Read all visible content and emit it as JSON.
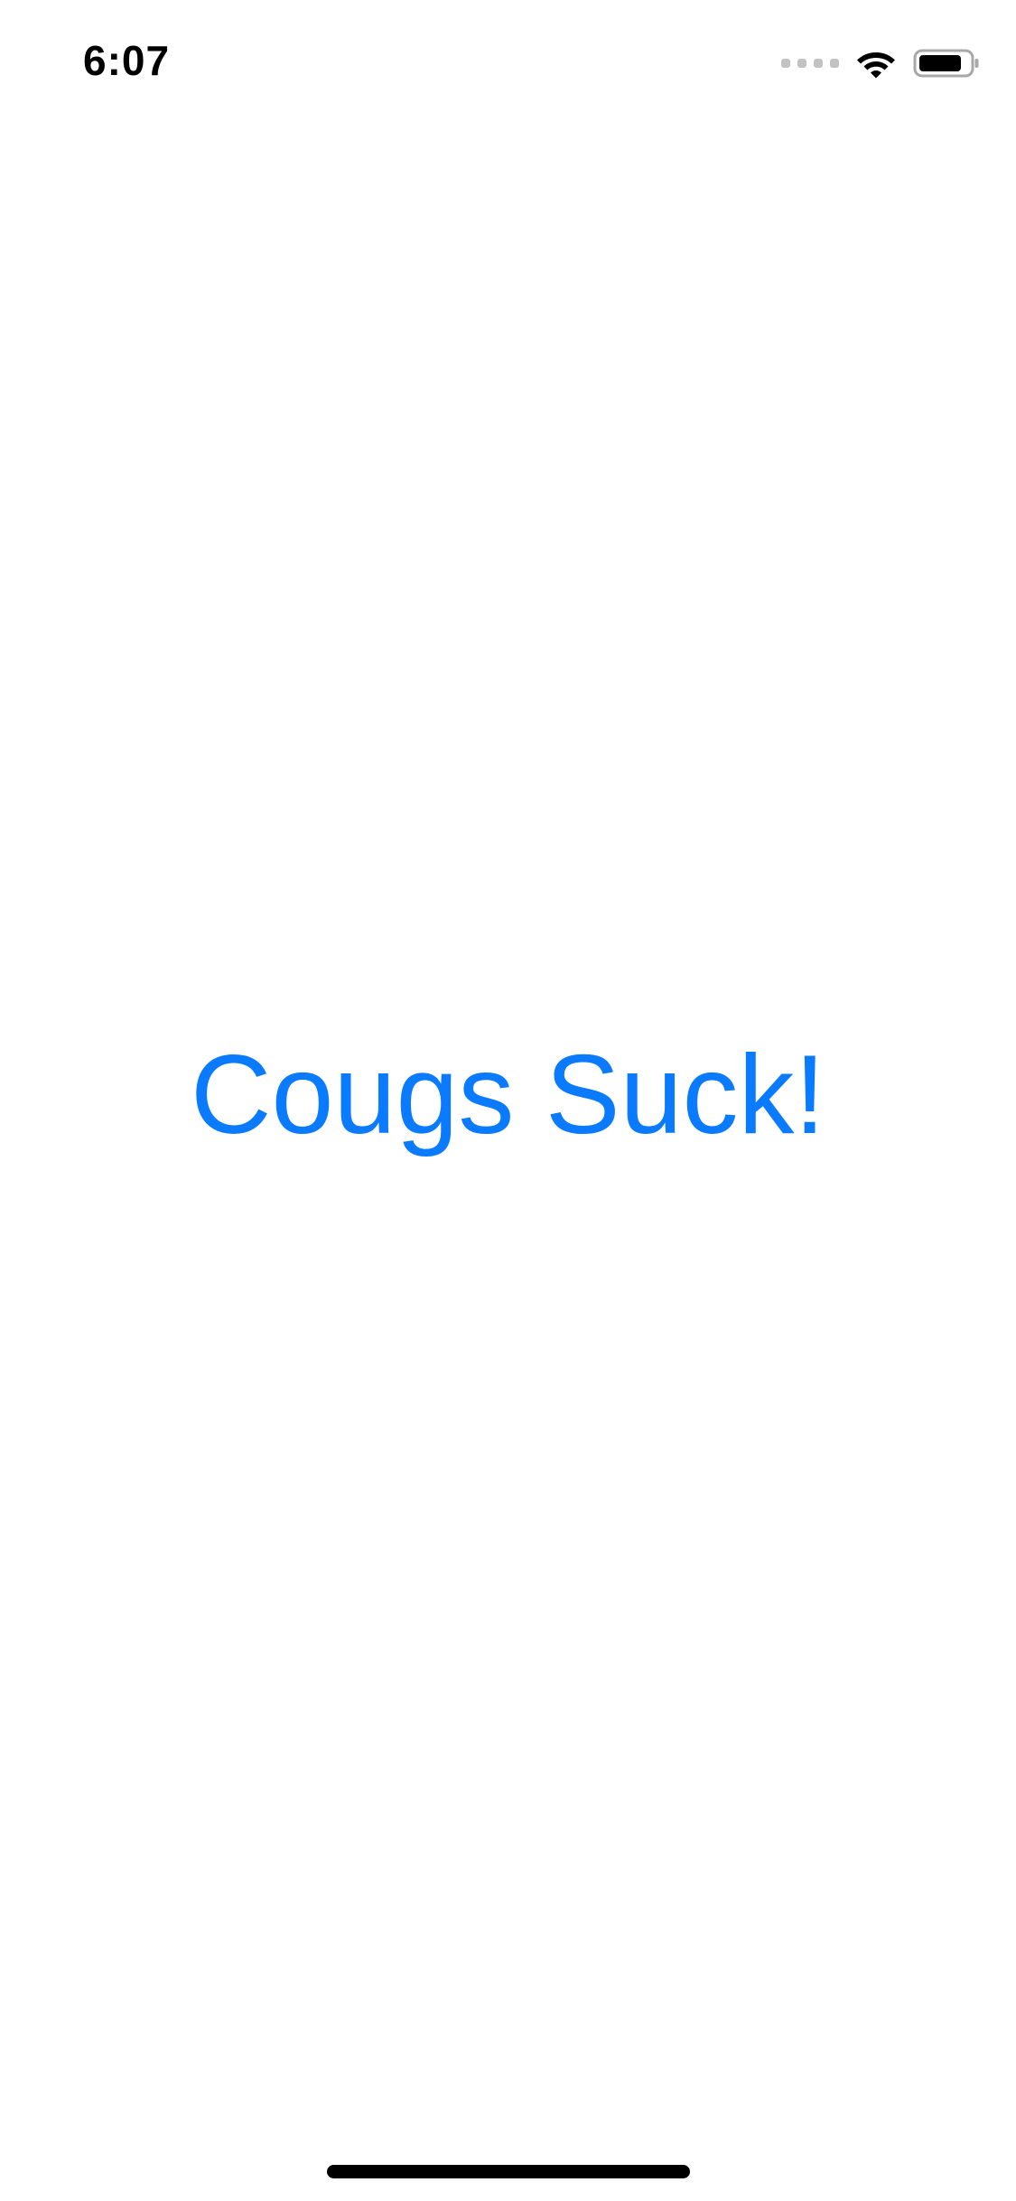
{
  "status_bar": {
    "time": "6:07",
    "icons": [
      "cellular-signal-icon",
      "wifi-icon",
      "battery-icon"
    ]
  },
  "main": {
    "label": "Cougs Suck!",
    "label_color": "#0a7aff"
  },
  "colors": {
    "background": "#ffffff",
    "text": "#000000",
    "accent": "#0a7aff"
  }
}
